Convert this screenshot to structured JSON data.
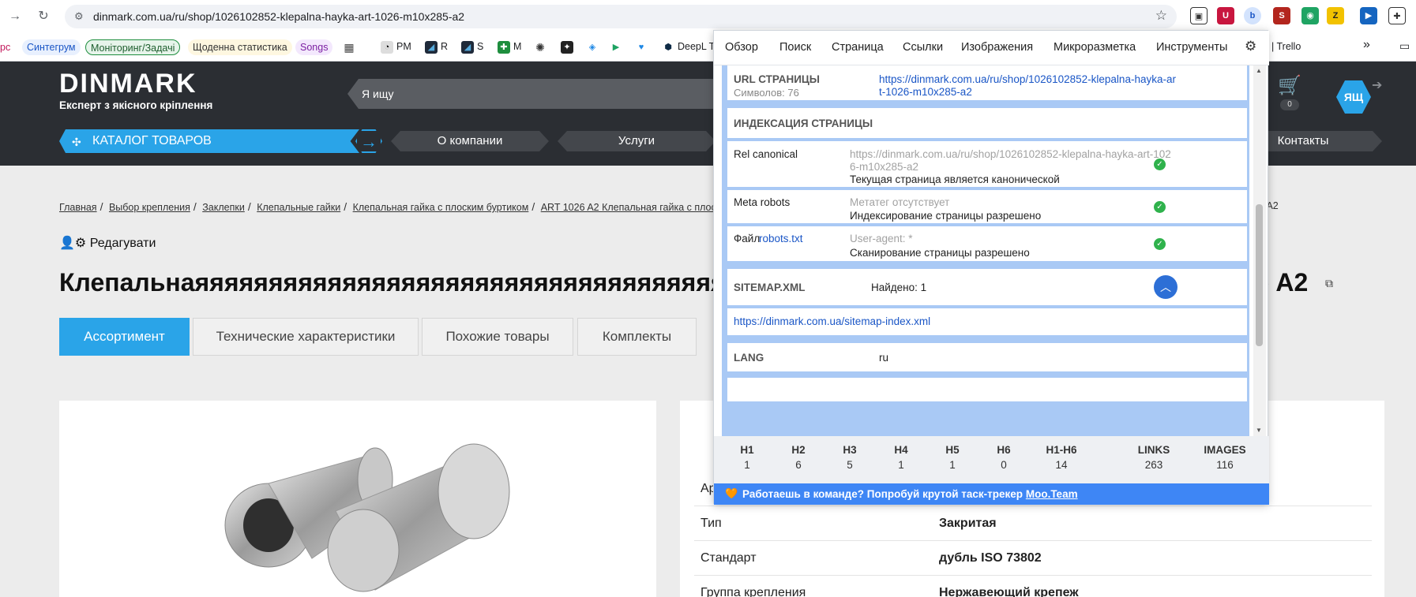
{
  "browser": {
    "url": "dinmark.com.ua/ru/shop/1026102852-klepalna-hayka-art-1026-m10x285-a2",
    "bookmarks": {
      "cut": "рс",
      "sintegrum": "Синтегрум",
      "monitoring": "Моніторинг/Задачі",
      "daily": "Щоденна статистика",
      "songs": "Songs",
      "pm": "PM",
      "r": "R",
      "s": "S",
      "m": "M",
      "deepl": "DeepL Tr",
      "trello": "| Trello"
    },
    "ext_label_avatar": "ЯЩ"
  },
  "site": {
    "logo": "DINMARK",
    "tagline": "Експерт з якісного кріплення",
    "search_placeholder": "Я ищу",
    "catalog": "КАТАЛОГ ТОВАРОВ",
    "menu": [
      "О компании",
      "Услуги",
      "Контакты"
    ],
    "cart_count": "0",
    "avatar": "ЯЩ",
    "breadcrumbs": [
      "Главная",
      "Выбор крепления",
      "Заклепки",
      "Клепальные гайки",
      "Клепальная гайка с плоским буртиком",
      "ART 1026 A2 Клепальная гайка с плоским"
    ],
    "breadcrumb_tail": "5 (0,5-3,0) A2",
    "edit_label": "Редагувати",
    "title": "Клепальнаяяяяяяяяяяяяяяяяяяяяяяяяяяяяяяяяяяяяяяяяяяяяяяяяяяяяя",
    "title_tail": ") A2",
    "tabs": [
      "Ассортимент",
      "Технические характеристики",
      "Похожие товары",
      "Комплекты"
    ],
    "specs": [
      {
        "k": "Ар",
        "v": ""
      },
      {
        "k": "Тип",
        "v": "Закритая"
      },
      {
        "k": "Стандарт",
        "v": "дубль ISO 73802"
      },
      {
        "k": "Группа крепления",
        "v": "Нержавеющий крепеж"
      }
    ]
  },
  "popup": {
    "tabs": [
      "Обзор",
      "Поиск",
      "Страница",
      "Ссылки",
      "Изображения",
      "Микроразметка",
      "Инструменты"
    ],
    "url_label": "URL СТРАНИЦЫ",
    "url_chars": "Символов: 76",
    "url_value_1": "https://dinmark.com.ua/ru/shop/1026102852-klepalna-hayka-ar",
    "url_value_2": "t-1026-m10x285-a2",
    "indexing_title": "ИНДЕКСАЦИЯ СТРАНИЦЫ",
    "canonical_label": "Rel canonical",
    "canonical_url_1": "https://dinmark.com.ua/ru/shop/1026102852-klepalna-hayka-art-102",
    "canonical_url_2": "6-m10x285-a2",
    "canonical_note": "Текущая страница является канонической",
    "robots_label": "Meta robots",
    "robots_value": "Метатег отсутствует",
    "robots_note": "Индексирование страницы разрешено",
    "robotstxt_prefix": "Файл",
    "robotstxt_link": "robots.txt",
    "robotstxt_value": "User-agent: *",
    "robotstxt_note": "Сканирование страницы разрешено",
    "sitemap_label": "SITEMAP.XML",
    "sitemap_found": "Найдено: 1",
    "sitemap_url": "https://dinmark.com.ua/sitemap-index.xml",
    "lang_label": "LANG",
    "lang_value": "ru",
    "stats": [
      {
        "h": "H1",
        "n": "1"
      },
      {
        "h": "H2",
        "n": "6"
      },
      {
        "h": "H3",
        "n": "5"
      },
      {
        "h": "H4",
        "n": "1"
      },
      {
        "h": "H5",
        "n": "1"
      },
      {
        "h": "H6",
        "n": "0"
      },
      {
        "h": "H1-H6",
        "n": "14"
      },
      {
        "h": "LINKS",
        "n": "263"
      },
      {
        "h": "IMAGES",
        "n": "116"
      }
    ],
    "promo_text": "Работаешь в команде? Попробуй крутой таск-трекер",
    "promo_link": "Moo.Team"
  }
}
